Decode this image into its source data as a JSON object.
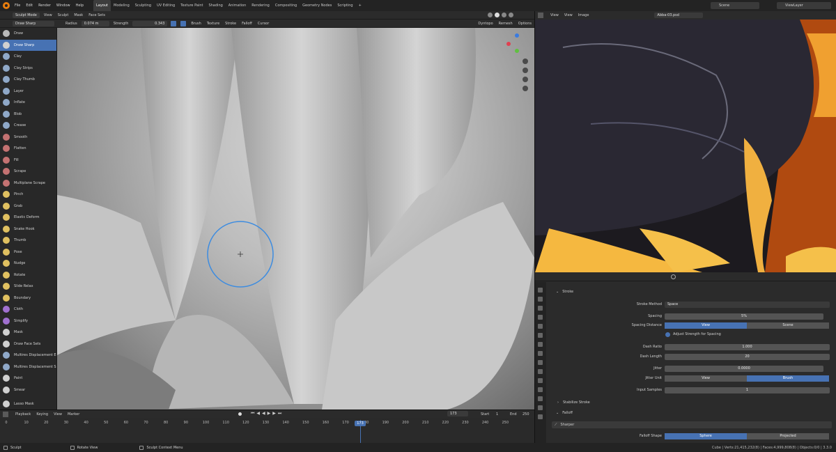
{
  "menu": {
    "items": [
      "File",
      "Edit",
      "Render",
      "Window",
      "Help"
    ]
  },
  "workspaces": [
    "Layout",
    "Modeling",
    "Sculpting",
    "UV Editing",
    "Texture Paint",
    "Shading",
    "Animation",
    "Rendering",
    "Compositing",
    "Geometry Nodes",
    "Scripting"
  ],
  "active_workspace": "Layout",
  "scene": {
    "label": "Scene",
    "view_layer": "ViewLayer"
  },
  "viewport_header": {
    "mode": "Sculpt Mode",
    "items": [
      "View",
      "Sculpt",
      "Mask",
      "Face Sets"
    ]
  },
  "tool_options": {
    "brush_name": "Draw Sharp",
    "radius_label": "Radius",
    "radius_value": "0.074 m",
    "strength_label": "Strength",
    "strength_value": "0.343",
    "menus": [
      "Brush",
      "Texture",
      "Stroke",
      "Falloff",
      "Cursor"
    ],
    "right_menus": [
      "Dyntopo",
      "Remesh",
      "Options"
    ]
  },
  "tools": [
    {
      "label": "Draw",
      "color": "#b9b9b9"
    },
    {
      "label": "Draw Sharp",
      "color": "#d0d0d0"
    },
    {
      "label": "Clay",
      "color": "#8fa8c8"
    },
    {
      "label": "Clay Strips",
      "color": "#8fa8c8"
    },
    {
      "label": "Clay Thumb",
      "color": "#8fa8c8"
    },
    {
      "label": "Layer",
      "color": "#8fa8c8"
    },
    {
      "label": "Inflate",
      "color": "#8fa8c8"
    },
    {
      "label": "Blob",
      "color": "#8fa8c8"
    },
    {
      "label": "Crease",
      "color": "#8fa8c8"
    },
    {
      "label": "Smooth",
      "color": "#c47272"
    },
    {
      "label": "Flatten",
      "color": "#c47272"
    },
    {
      "label": "Fill",
      "color": "#c47272"
    },
    {
      "label": "Scrape",
      "color": "#c47272"
    },
    {
      "label": "Multiplane Scrape",
      "color": "#c47272"
    },
    {
      "label": "Pinch",
      "color": "#e0c060"
    },
    {
      "label": "Grab",
      "color": "#e0c060"
    },
    {
      "label": "Elastic Deform",
      "color": "#e0c060"
    },
    {
      "label": "Snake Hook",
      "color": "#e0c060"
    },
    {
      "label": "Thumb",
      "color": "#e0c060"
    },
    {
      "label": "Pose",
      "color": "#e0c060"
    },
    {
      "label": "Nudge",
      "color": "#e0c060"
    },
    {
      "label": "Rotate",
      "color": "#e0c060"
    },
    {
      "label": "Slide Relax",
      "color": "#e0c060"
    },
    {
      "label": "Boundary",
      "color": "#e0c060"
    },
    {
      "label": "Cloth",
      "color": "#a070d0"
    },
    {
      "label": "Simplify",
      "color": "#a070d0"
    },
    {
      "label": "Mask",
      "color": "#d0d0d0"
    },
    {
      "label": "Draw Face Sets",
      "color": "#d0d0d0"
    },
    {
      "label": "Multires Displacement Er...",
      "color": "#8fa8c8"
    },
    {
      "label": "Multires Displacement S...",
      "color": "#8fa8c8"
    },
    {
      "label": "Paint",
      "color": "#d0d0d0"
    },
    {
      "label": "Smear",
      "color": "#d0d0d0"
    },
    {
      "label": "Lasso Mask",
      "color": "#d0d0d0"
    }
  ],
  "active_tool": "Draw Sharp",
  "image_editor": {
    "menus": [
      "View",
      "View",
      "Image"
    ],
    "image_name": "Abba-03.psd"
  },
  "properties": {
    "stroke_header": "Stroke",
    "stroke_method_label": "Stroke Method",
    "stroke_method_value": "Space",
    "spacing_label": "Spacing",
    "spacing_value": "5%",
    "spacing_distance_label": "Spacing Distance",
    "spacing_distance_options": [
      "View",
      "Scene"
    ],
    "spacing_distance_selected": "View",
    "adjust_strength_label": "Adjust Strength for Spacing",
    "dash_ratio_label": "Dash Ratio",
    "dash_ratio_value": "1.000",
    "dash_length_label": "Dash Length",
    "dash_length_value": "20",
    "jitter_label": "Jitter",
    "jitter_value": "0.0000",
    "jitter_unit_label": "Jitter Unit",
    "jitter_unit_options": [
      "View",
      "Brush"
    ],
    "jitter_unit_selected": "Brush",
    "input_samples_label": "Input Samples",
    "input_samples_value": "1",
    "stabilize_header": "Stabilize Stroke",
    "falloff_header": "Falloff",
    "falloff_preset": "Sharper",
    "falloff_shape_label": "Falloff Shape",
    "falloff_shape_options": [
      "Sphere",
      "Projected"
    ],
    "falloff_shape_selected": "Sphere"
  },
  "timeline": {
    "menus": [
      "Playback",
      "Keying",
      "View",
      "Marker"
    ],
    "frame_current": "173",
    "start_label": "Start",
    "start_value": "1",
    "end_label": "End",
    "end_value": "250",
    "ticks": [
      "0",
      "10",
      "20",
      "30",
      "40",
      "50",
      "60",
      "70",
      "80",
      "90",
      "100",
      "110",
      "120",
      "130",
      "140",
      "150",
      "160",
      "170",
      "180",
      "190",
      "200",
      "210",
      "220",
      "230",
      "240",
      "250"
    ],
    "current_frame_label": "173"
  },
  "statusbar": {
    "left": "Sculpt",
    "middle": "Rotate View",
    "right_hint": "Sculpt Context Menu",
    "stats": "Cube | Verts:21,415,232(8) | Faces:4,999,808(8) | Objects:0/0 | 3.3.0"
  }
}
